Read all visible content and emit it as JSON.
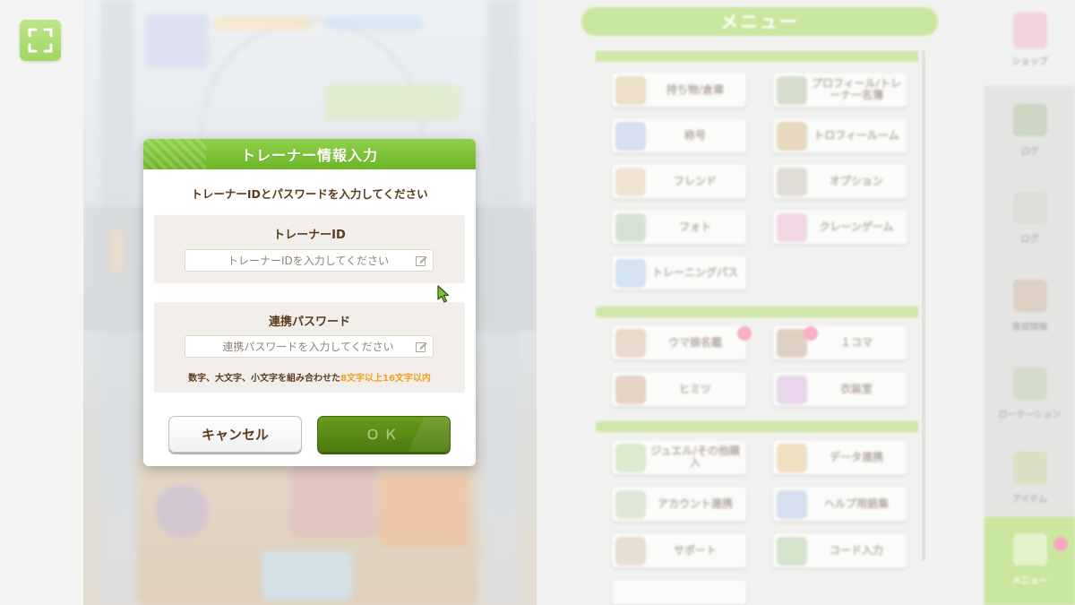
{
  "dialog": {
    "title": "トレーナー情報入力",
    "subtitle": "トレーナーIDとパスワードを入力してください",
    "trainer_id": {
      "label": "トレーナーID",
      "placeholder": "トレーナーIDを入力してください",
      "value": ""
    },
    "password": {
      "label": "連携パスワード",
      "placeholder": "連携パスワードを入力してください",
      "value": "",
      "hint_prefix": "数字、大文字、小文字を組み合わせた",
      "hint_accent": "8文字以上16文字以内"
    },
    "cancel_label": "キャンセル",
    "ok_label": "ＯＫ",
    "ok_enabled": false
  },
  "menu": {
    "title": "メニュー",
    "tiles": [
      {
        "label": "持ち物/倉庫"
      },
      {
        "label": "プロフィール/トレーナー名簿"
      },
      {
        "label": "称号"
      },
      {
        "label": "トロフィールーム"
      },
      {
        "label": "フレンド"
      },
      {
        "label": "オプション"
      },
      {
        "label": "フォト"
      },
      {
        "label": "クレーンゲーム"
      },
      {
        "label": "トレーニングパス"
      },
      {
        "label": "ウマ娘名鑑"
      },
      {
        "label": "１コマ"
      },
      {
        "label": "ヒミツ"
      },
      {
        "label": "衣装室"
      },
      {
        "label": "ジュエル/その他購入"
      },
      {
        "label": "データ連携"
      },
      {
        "label": "アカウント連携"
      },
      {
        "label": "ヘルプ用語集"
      },
      {
        "label": "サポート"
      },
      {
        "label": "コード入力"
      }
    ]
  },
  "side_rail": {
    "items": [
      {
        "label": "ショップ"
      },
      {
        "label": "ログ"
      },
      {
        "label": "育成情報"
      },
      {
        "label": "ローテーション"
      },
      {
        "label": "アイテム"
      },
      {
        "label": "メニュー"
      }
    ]
  },
  "colors": {
    "accent_green": "#7cc23a",
    "ok_green": "#5a8a16",
    "hint_orange": "#f0a020",
    "text_brown": "#5a3b1c"
  }
}
